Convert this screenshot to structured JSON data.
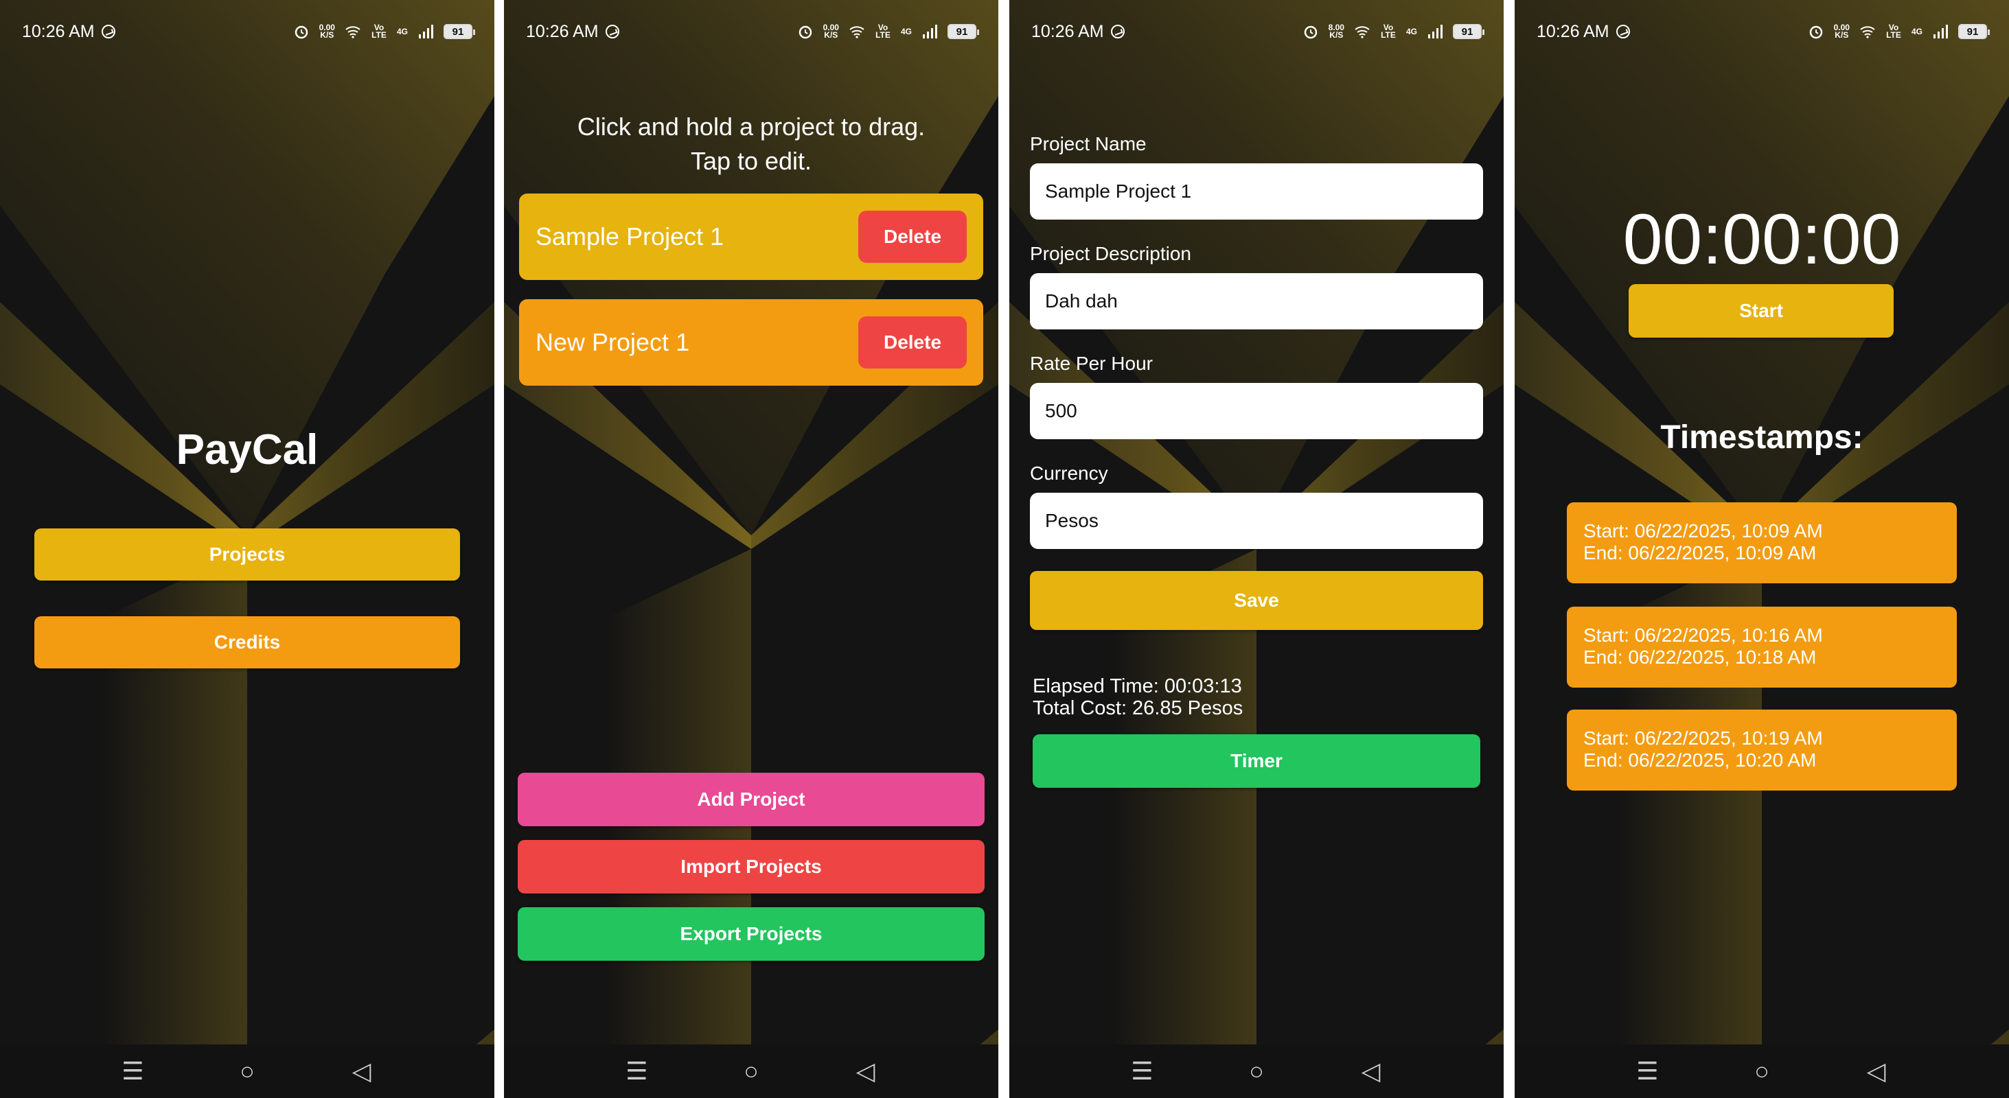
{
  "status_bar": {
    "time": "10:26 AM",
    "speed_value": "0.00",
    "speed_value_alt": "8.00",
    "speed_unit": "K/S",
    "volte": "Vo LTE",
    "network": "4G",
    "battery": "91"
  },
  "nav_icons": [
    "menu-icon",
    "home-icon",
    "back-icon"
  ],
  "colors": {
    "yellow": "#e6b30f",
    "orange": "#f39c12",
    "pink": "#e84a94",
    "red": "#ef4444",
    "green": "#22c55e"
  },
  "home": {
    "title": "PayCal",
    "projects_button": "Projects",
    "credits_button": "Credits"
  },
  "projects": {
    "instruction_line1": "Click and hold a project to drag.",
    "instruction_line2": "Tap to edit.",
    "items": [
      {
        "name": "Sample Project 1",
        "delete_label": "Delete"
      },
      {
        "name": "New Project 1",
        "delete_label": "Delete"
      }
    ],
    "add_button": "Add Project",
    "import_button": "Import Projects",
    "export_button": "Export Projects"
  },
  "edit": {
    "name_label": "Project Name",
    "name_value": "Sample Project 1",
    "description_label": "Project Description",
    "description_value": "Dah dah",
    "rate_label": "Rate Per Hour",
    "rate_value": "500",
    "currency_label": "Currency",
    "currency_value": "Pesos",
    "save_button": "Save",
    "elapsed_time": "Elapsed Time: 00:03:13",
    "total_cost": "Total Cost: 26.85 Pesos",
    "timer_button": "Timer"
  },
  "timer": {
    "display": "00:00:00",
    "start_button": "Start",
    "timestamps_title": "Timestamps:",
    "timestamps": [
      {
        "start": "Start: 06/22/2025, 10:09 AM",
        "end": "End: 06/22/2025, 10:09 AM"
      },
      {
        "start": "Start: 06/22/2025, 10:16 AM",
        "end": "End: 06/22/2025, 10:18 AM"
      },
      {
        "start": "Start: 06/22/2025, 10:19 AM",
        "end": "End: 06/22/2025, 10:20 AM"
      }
    ]
  }
}
